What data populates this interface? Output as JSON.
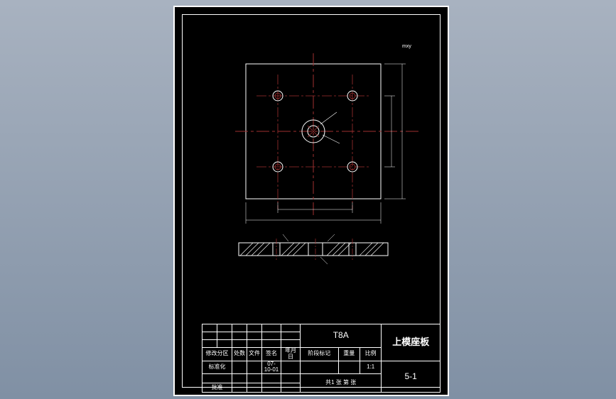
{
  "title_block": {
    "material": "T8A",
    "part_name": "上模座板",
    "part_number": "5-1",
    "scale_label": "比例",
    "scale_value": "1:1",
    "weight_label": "重量",
    "stage_label": "阶段标记",
    "sheet_label": "共1 张 第 张",
    "row1_c1": "修改分区",
    "row1_c2": "处数",
    "row1_c3": "文件",
    "row1_c4": "签名",
    "row1_c5": "年月日",
    "row2_c1": "标准化",
    "row2_date": "07-10-01",
    "approve": "批准"
  },
  "annotations": {
    "top_right": "mxy",
    "center_arrow1": "",
    "center_arrow2": "",
    "bottom_dim1": "",
    "section_left": "",
    "section_right": ""
  },
  "chart_data": {
    "type": "engineering_drawing",
    "views": [
      {
        "name": "top_view",
        "shape": "square_plate",
        "outer_size_est": 200,
        "center_hole": {
          "type": "stepped_bore",
          "diameter_est": 30
        },
        "bolt_holes": {
          "count": 4,
          "pattern": "rectangular",
          "diameter_est": 12
        },
        "centerlines": [
          "horizontal",
          "vertical"
        ]
      },
      {
        "name": "section_view",
        "shape": "plate_cross_section",
        "thickness_est": 20,
        "hatching": true
      }
    ],
    "dimensions_visible": [
      "width",
      "hole_spacing_x",
      "hole_spacing_y",
      "center_bore"
    ],
    "material": "T8A",
    "part": "上模座板",
    "drawing_number": "5-1",
    "scale": "1:1"
  }
}
